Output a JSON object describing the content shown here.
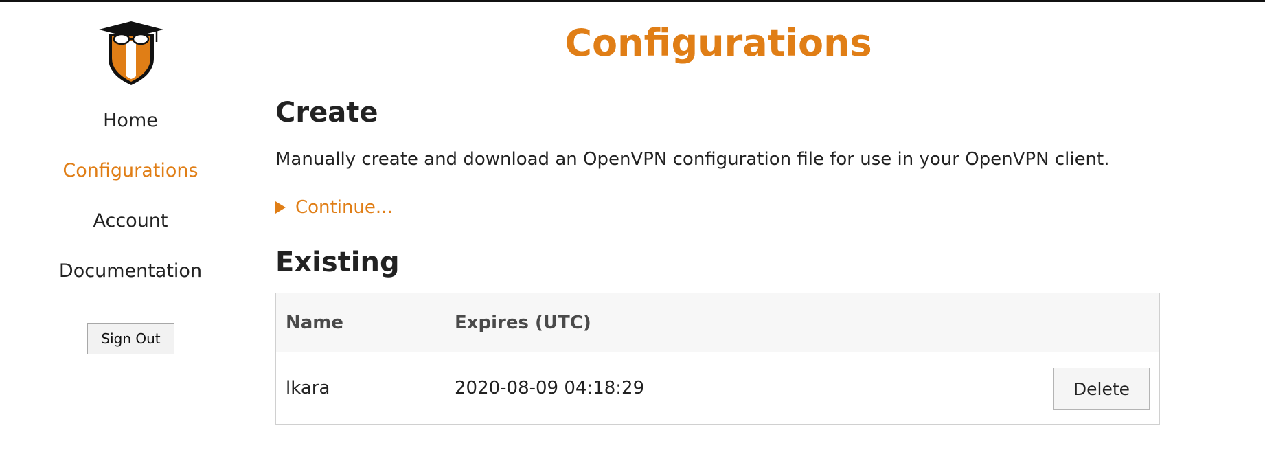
{
  "sidebar": {
    "logo_icon": "shield-mortarboard-logo",
    "nav": [
      {
        "label": "Home",
        "active": false
      },
      {
        "label": "Configurations",
        "active": true
      },
      {
        "label": "Account",
        "active": false
      },
      {
        "label": "Documentation",
        "active": false
      }
    ],
    "sign_out_label": "Sign Out"
  },
  "main": {
    "page_title": "Configurations",
    "create": {
      "title": "Create",
      "description": "Manually create and download an OpenVPN configuration file for use in your OpenVPN client.",
      "continue_label": "Continue..."
    },
    "existing": {
      "title": "Existing",
      "columns": [
        "Name",
        "Expires (UTC)"
      ],
      "rows": [
        {
          "name": "lkara",
          "expires": "2020-08-09 04:18:29",
          "action_label": "Delete"
        }
      ]
    }
  },
  "colors": {
    "accent": "#e07e16",
    "text": "#222222",
    "header_bg": "#f7f7f7"
  }
}
